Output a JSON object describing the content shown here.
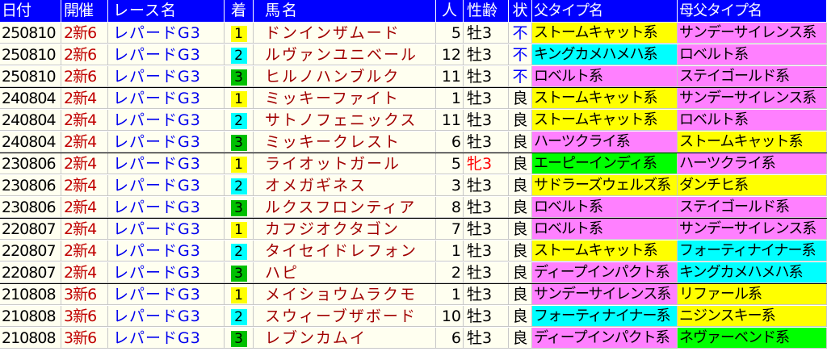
{
  "colors": {
    "header_bg": "#0000ff",
    "row_bg": "#fffff0",
    "yellow": "#ffff00",
    "cyan": "#00ffff",
    "green": "#00c000",
    "bright_green": "#00ff00",
    "magenta": "#ff80ff",
    "kai_text": "#c00000",
    "race_text": "#0000ee",
    "horse_text": "#a00000",
    "cond_fu_text": "#0000ff",
    "filly_text": "#ff0000"
  },
  "header": {
    "date": "日付",
    "kai": "開催",
    "race": "レース名",
    "chaku": "着",
    "name": "馬名",
    "ninki": "人",
    "sex_age": "性齢",
    "cond": "状",
    "sire_type": "父タイプ名",
    "damsire_type": "母父タイプ名"
  },
  "rows": [
    {
      "date": "250810",
      "kai": "2新6",
      "race": "レパードG3",
      "chaku": "1",
      "name": "ドンインザムード",
      "ninki": "5",
      "sex_age": "牡3",
      "cond": "不",
      "sire_type": "ストームキャット系",
      "sire_color": "yellow",
      "damsire_type": "サンデーサイレンス系",
      "damsire_color": "magenta"
    },
    {
      "date": "250810",
      "kai": "2新6",
      "race": "レパードG3",
      "chaku": "2",
      "name": "ルヴァンユニベール",
      "ninki": "12",
      "sex_age": "牡3",
      "cond": "不",
      "sire_type": "キングカメハメハ系",
      "sire_color": "cyan",
      "damsire_type": "ロベルト系",
      "damsire_color": "magenta"
    },
    {
      "date": "250810",
      "kai": "2新6",
      "race": "レパードG3",
      "chaku": "3",
      "name": "ヒルノハンブルク",
      "ninki": "11",
      "sex_age": "牡3",
      "cond": "不",
      "sire_type": "ロベルト系",
      "sire_color": "magenta",
      "damsire_type": "ステイゴールド系",
      "damsire_color": "magenta"
    },
    {
      "date": "240804",
      "kai": "2新4",
      "race": "レパードG3",
      "chaku": "1",
      "name": "ミッキーファイト",
      "ninki": "1",
      "sex_age": "牡3",
      "cond": "良",
      "sire_type": "ストームキャット系",
      "sire_color": "yellow",
      "damsire_type": "サンデーサイレンス系",
      "damsire_color": "magenta"
    },
    {
      "date": "240804",
      "kai": "2新4",
      "race": "レパードG3",
      "chaku": "2",
      "name": "サトノフェニックス",
      "ninki": "11",
      "sex_age": "牡3",
      "cond": "良",
      "sire_type": "ストームキャット系",
      "sire_color": "yellow",
      "damsire_type": "ロベルト系",
      "damsire_color": "magenta"
    },
    {
      "date": "240804",
      "kai": "2新4",
      "race": "レパードG3",
      "chaku": "3",
      "name": "ミッキークレスト",
      "ninki": "6",
      "sex_age": "牡3",
      "cond": "良",
      "sire_type": "ハーツクライ系",
      "sire_color": "magenta",
      "damsire_type": "ストームキャット系",
      "damsire_color": "yellow"
    },
    {
      "date": "230806",
      "kai": "2新4",
      "race": "レパードG3",
      "chaku": "1",
      "name": "ライオットガール",
      "ninki": "5",
      "sex_age": "牝3",
      "cond": "良",
      "sire_type": "エーピーインディ系",
      "sire_color": "bright_green",
      "damsire_type": "ハーツクライ系",
      "damsire_color": "magenta"
    },
    {
      "date": "230806",
      "kai": "2新4",
      "race": "レパードG3",
      "chaku": "2",
      "name": "オメガギネス",
      "ninki": "3",
      "sex_age": "牡3",
      "cond": "良",
      "sire_type": "サドラーズウェルズ系",
      "sire_color": "yellow",
      "damsire_type": "ダンチヒ系",
      "damsire_color": "yellow"
    },
    {
      "date": "230806",
      "kai": "2新4",
      "race": "レパードG3",
      "chaku": "3",
      "name": "ルクスフロンティア",
      "ninki": "8",
      "sex_age": "牡3",
      "cond": "良",
      "sire_type": "ロベルト系",
      "sire_color": "magenta",
      "damsire_type": "ステイゴールド系",
      "damsire_color": "magenta"
    },
    {
      "date": "220807",
      "kai": "2新4",
      "race": "レパードG3",
      "chaku": "1",
      "name": "カフジオクタゴン",
      "ninki": "7",
      "sex_age": "牡3",
      "cond": "良",
      "sire_type": "ロベルト系",
      "sire_color": "magenta",
      "damsire_type": "サンデーサイレンス系",
      "damsire_color": "magenta"
    },
    {
      "date": "220807",
      "kai": "2新4",
      "race": "レパードG3",
      "chaku": "2",
      "name": "タイセイドレフォン",
      "ninki": "1",
      "sex_age": "牡3",
      "cond": "良",
      "sire_type": "ストームキャット系",
      "sire_color": "yellow",
      "damsire_type": "フォーティナイナー系",
      "damsire_color": "cyan"
    },
    {
      "date": "220807",
      "kai": "2新4",
      "race": "レパードG3",
      "chaku": "3",
      "name": "ハピ",
      "ninki": "2",
      "sex_age": "牡3",
      "cond": "良",
      "sire_type": "ディープインパクト系",
      "sire_color": "magenta",
      "damsire_type": "キングカメハメハ系",
      "damsire_color": "cyan"
    },
    {
      "date": "210808",
      "kai": "3新6",
      "race": "レパードG3",
      "chaku": "1",
      "name": "メイショウムラクモ",
      "ninki": "1",
      "sex_age": "牡3",
      "cond": "良",
      "sire_type": "サンデーサイレンス系",
      "sire_color": "magenta",
      "damsire_type": "リファール系",
      "damsire_color": "yellow"
    },
    {
      "date": "210808",
      "kai": "3新6",
      "race": "レパードG3",
      "chaku": "2",
      "name": "スウィーブザボード",
      "ninki": "10",
      "sex_age": "牡3",
      "cond": "良",
      "sire_type": "フォーティナイナー系",
      "sire_color": "cyan",
      "damsire_type": "ニジンスキー系",
      "damsire_color": "yellow"
    },
    {
      "date": "210808",
      "kai": "3新6",
      "race": "レパードG3",
      "chaku": "3",
      "name": "レブンカムイ",
      "ninki": "6",
      "sex_age": "牡3",
      "cond": "良",
      "sire_type": "ディープインパクト系",
      "sire_color": "magenta",
      "damsire_type": "ネヴァーベンド系",
      "damsire_color": "bright_green"
    }
  ]
}
